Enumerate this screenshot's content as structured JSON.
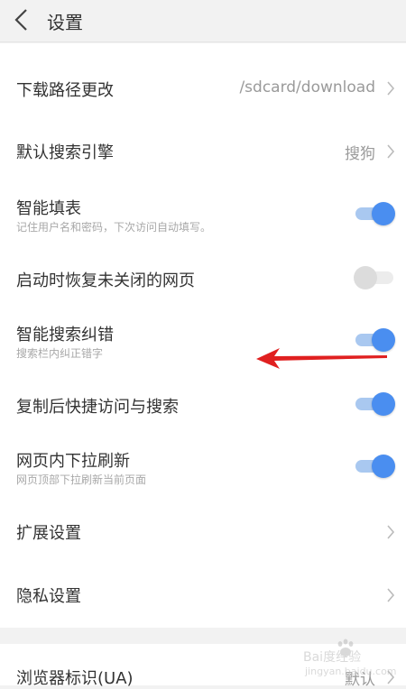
{
  "header": {
    "title": "设置"
  },
  "rows": [
    {
      "title": "下载路径更改",
      "value": "/sdcard/download"
    },
    {
      "title": "默认搜索引擎",
      "value": "搜狗"
    },
    {
      "title": "智能填表",
      "subtitle": "记住用户名和密码，下次访问自动填写。",
      "enabled": true
    },
    {
      "title": "启动时恢复未关闭的网页",
      "enabled": false
    },
    {
      "title": "智能搜索纠错",
      "subtitle": "搜索栏内纠正错字",
      "enabled": true
    },
    {
      "title": "复制后快捷访问与搜索",
      "enabled": true
    },
    {
      "title": "网页内下拉刷新",
      "subtitle": "网页顶部下拉刷新当前页面",
      "enabled": true
    },
    {
      "title": "扩展设置"
    },
    {
      "title": "隐私设置"
    }
  ],
  "section2": {
    "title": "浏览器标识(UA)",
    "value": "默认"
  },
  "watermark": {
    "line1": "Bai度经验",
    "line2": "jingyan.baidu.com"
  },
  "colors": {
    "accent": "#4a8ef0",
    "annotation_arrow": "#e02020"
  }
}
